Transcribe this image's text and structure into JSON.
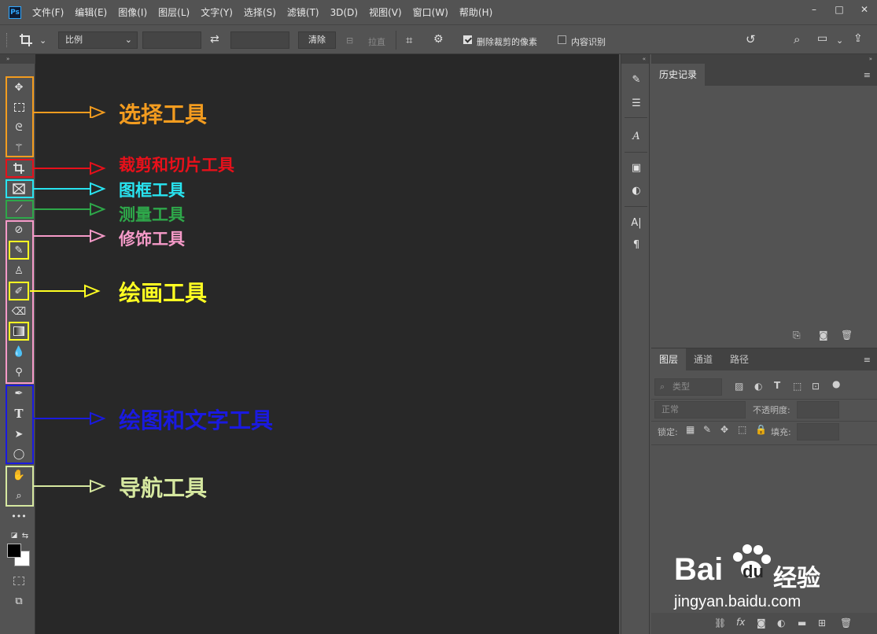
{
  "app": {
    "logo": "Ps"
  },
  "menu": [
    "文件(F)",
    "编辑(E)",
    "图像(I)",
    "图层(L)",
    "文字(Y)",
    "选择(S)",
    "滤镜(T)",
    "3D(D)",
    "视图(V)",
    "窗口(W)",
    "帮助(H)"
  ],
  "window_controls": {
    "minimize": "–",
    "maximize": "□",
    "close": "✕"
  },
  "options_bar": {
    "tool_icon": "crop-icon",
    "ratio_select": "比例",
    "clear_button": "清除",
    "straighten_label": "拉直",
    "delete_cropped_label": "删除裁剪的像素",
    "delete_cropped_checked": true,
    "content_aware_label": "内容识别",
    "content_aware_checked": false
  },
  "toolbar": {
    "tools": [
      "move",
      "rect-marquee",
      "lasso",
      "magic-wand",
      "crop",
      "frame",
      "eyedropper",
      "healing-brush",
      "brush",
      "clone-stamp",
      "history-brush",
      "eraser",
      "gradient",
      "blur",
      "dodge",
      "pen",
      "type",
      "path-select",
      "ellipse",
      "hand",
      "zoom"
    ],
    "more_label": "•••"
  },
  "annotations": [
    {
      "text": "选择工具",
      "color": "#f39c1f"
    },
    {
      "text": "裁剪和切片工具",
      "color": "#e8101a"
    },
    {
      "text": "图框工具",
      "color": "#28e4f0"
    },
    {
      "text": "测量工具",
      "color": "#2ea84a"
    },
    {
      "text": "修饰工具",
      "color": "#f59ac8"
    },
    {
      "text": "绘画工具",
      "color": "#ffff22"
    },
    {
      "text": "绘图和文字工具",
      "color": "#1a1ae0"
    },
    {
      "text": "导航工具",
      "color": "#d6e8a0"
    }
  ],
  "history_panel": {
    "tab": "历史记录"
  },
  "layers_panel": {
    "tabs": [
      "图层",
      "通道",
      "路径"
    ],
    "filter_placeholder": "类型",
    "blend_mode": "正常",
    "opacity_label": "不透明度:",
    "lock_label": "锁定:",
    "fill_label": "填充:"
  },
  "watermark": {
    "brand": "Bai",
    "brand2": "du",
    "brand_cn": "经验",
    "url": "jingyan.baidu.com"
  }
}
